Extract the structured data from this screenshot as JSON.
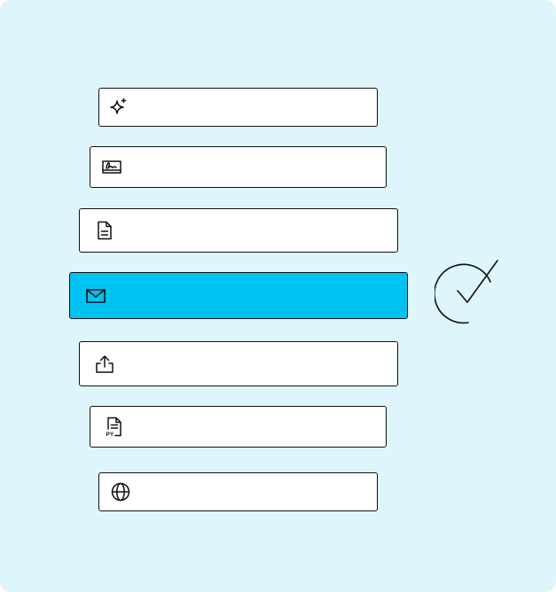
{
  "options": [
    {
      "icon": "sparkle-icon",
      "label": ""
    },
    {
      "icon": "signature-icon",
      "label": ""
    },
    {
      "icon": "document-icon",
      "label": ""
    },
    {
      "icon": "envelope-icon",
      "label": "",
      "selected": true
    },
    {
      "icon": "upload-icon",
      "label": ""
    },
    {
      "icon": "python-file-icon",
      "label": "",
      "badge": "PY"
    },
    {
      "icon": "globe-icon",
      "label": ""
    }
  ],
  "status": {
    "icon": "check-circle-icon"
  },
  "colors": {
    "background": "#dff5fc",
    "selected": "#00c2f2",
    "outline": "#111111",
    "option_fill": "#ffffff"
  }
}
